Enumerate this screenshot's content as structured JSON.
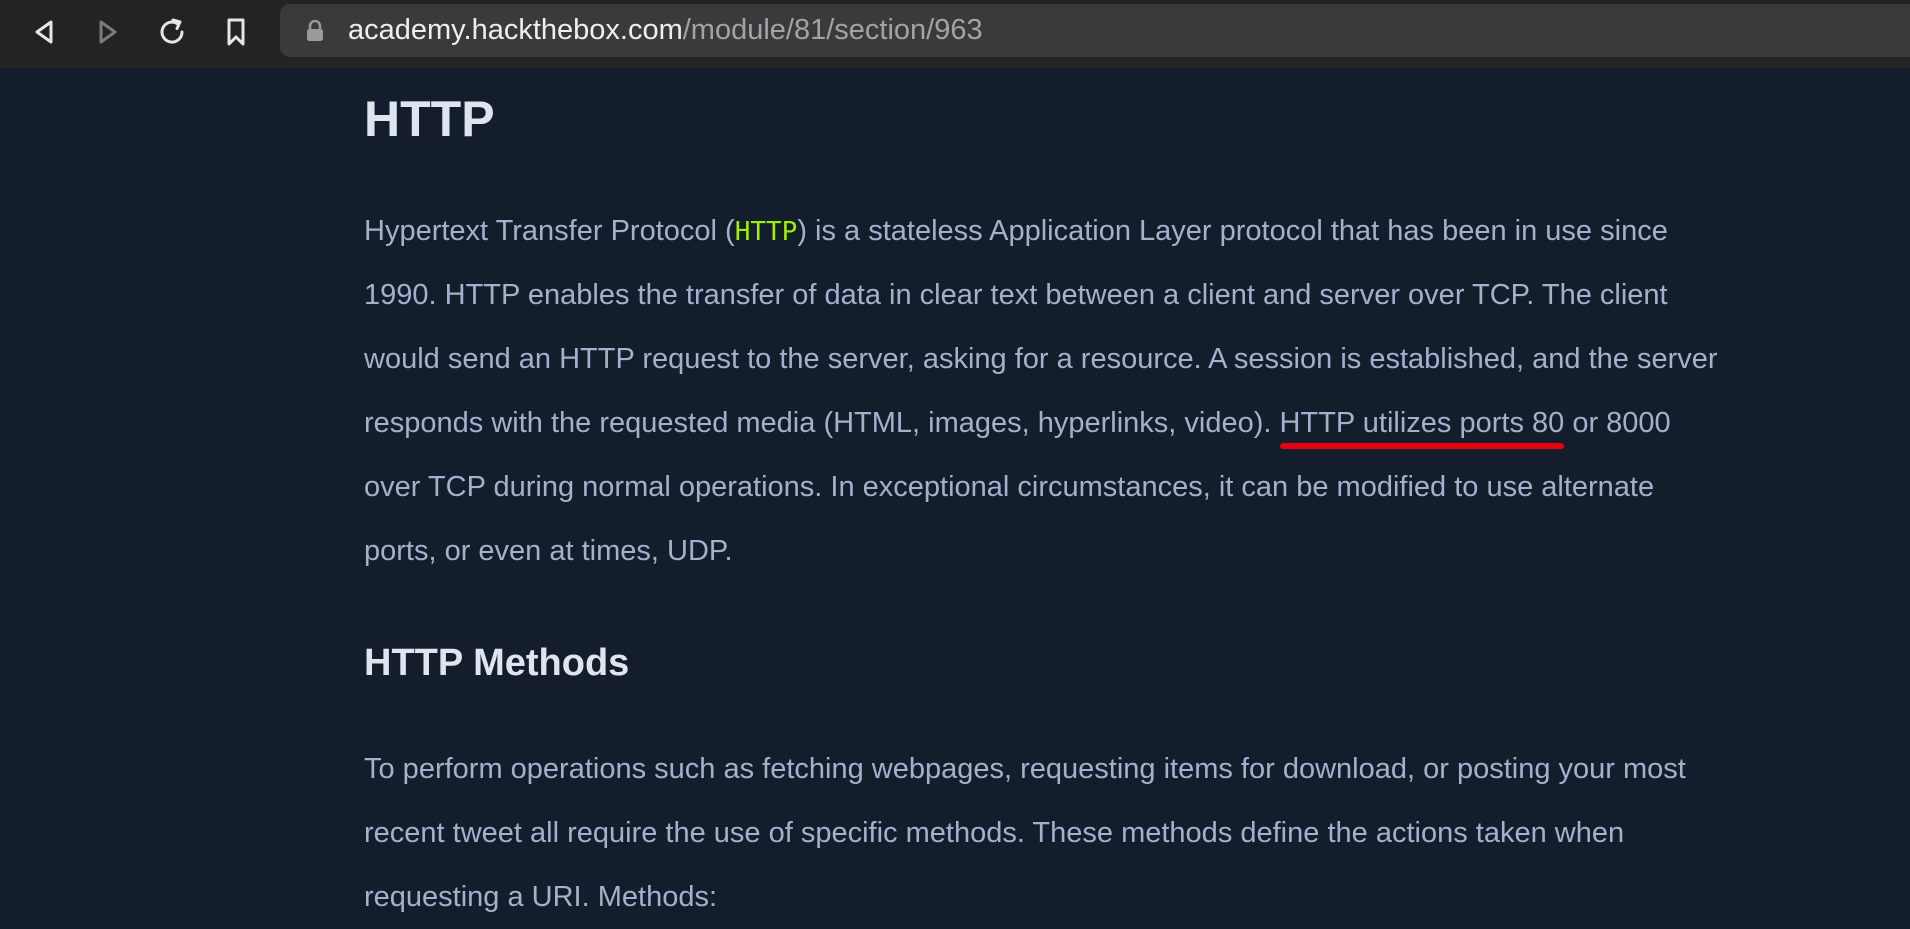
{
  "browser": {
    "url_host": "academy.hackthebox.com",
    "url_path": "/module/81/section/963",
    "icons": {
      "back": "back-icon",
      "forward": "forward-icon",
      "reload": "reload-icon",
      "bookmark": "bookmark-icon",
      "lock": "lock-icon"
    }
  },
  "article": {
    "title": "HTTP",
    "intro": {
      "line1_pre": "Hypertext Transfer Protocol (",
      "line1_code": "HTTP",
      "line1_post": ") is a stateless Application Layer protocol that has been in use since",
      "line2": "1990. HTTP enables the transfer of data in clear text between a client and server over TCP. The client",
      "line3": "would send an HTTP request to the server, asking for a resource. A session is established, and the server",
      "line4_pre": "responds with the requested media (HTML, images, hyperlinks, video). ",
      "line4_highlight": "HTTP utilizes ports 80",
      "line4_post": " or 8000",
      "line5": "over TCP during normal operations. In exceptional circumstances, it can be modified to use alternate",
      "line6": "ports, or even at times, UDP."
    },
    "section_title": "HTTP Methods",
    "methods": {
      "line1": "To perform operations such as fetching webpages, requesting items for download, or posting your most",
      "line2": "recent tweet all require the use of specific methods. These methods define the actions taken when",
      "line3": "requesting a URI. Methods:"
    }
  },
  "colors": {
    "page_background": "#141d2b",
    "heading": "#dfe5ee",
    "body_text": "#a4b1cd",
    "inline_code": "#9fef00",
    "annotation_underline": "#e8000f",
    "toolbar": "#232325",
    "addressbar": "#3a3a3d"
  }
}
